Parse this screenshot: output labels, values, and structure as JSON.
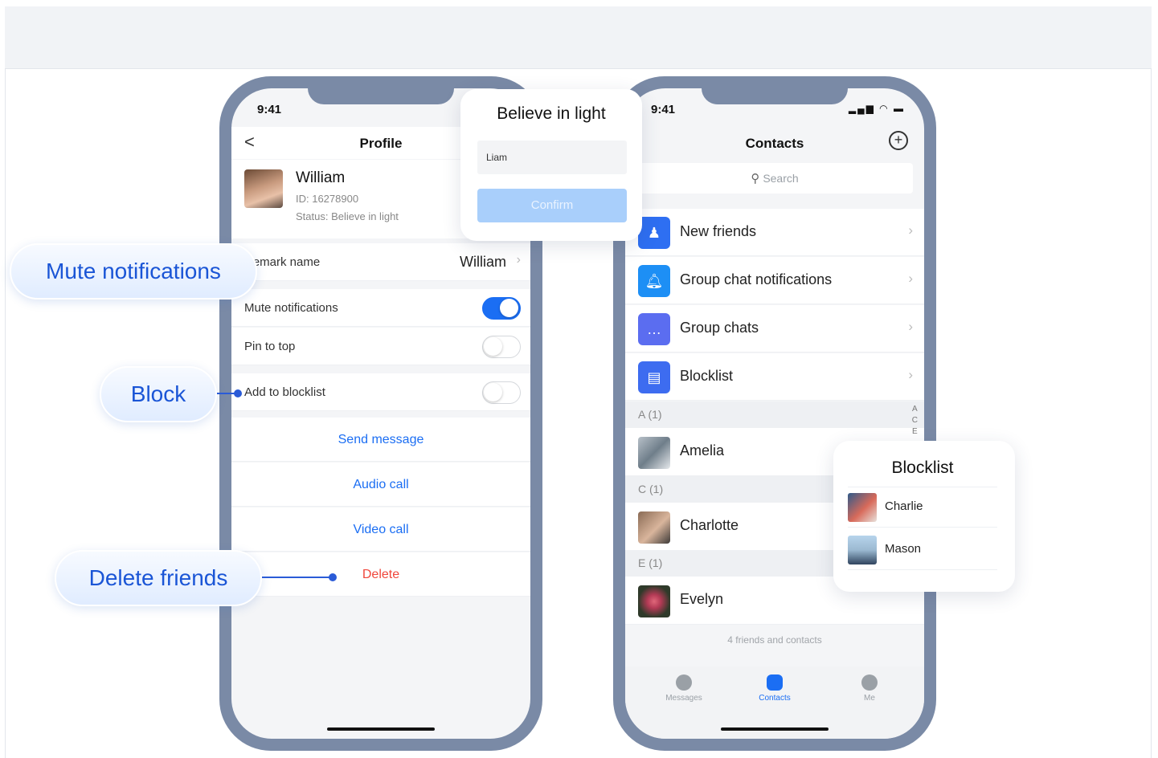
{
  "left_phone": {
    "time": "9:41",
    "nav": {
      "back": "<",
      "title": "Profile"
    },
    "profile": {
      "name": "William",
      "id": "ID: 16278900",
      "status": "Status: Believe in light"
    },
    "remark": {
      "label": "Remark name",
      "value": "William"
    },
    "toggles": [
      {
        "label": "Mute notifications",
        "on": true
      },
      {
        "label": "Pin to top",
        "on": false
      },
      {
        "label": "Add to blocklist",
        "on": false
      }
    ],
    "actions": [
      "Send message",
      "Audio call",
      "Video call",
      "Delete"
    ]
  },
  "status_popup": {
    "title": "Believe in light",
    "input_value": "Liam",
    "confirm_label": "Confirm"
  },
  "right_phone": {
    "time": "9:41",
    "title": "Contacts",
    "search_placeholder": "Search",
    "entries": [
      "New friends",
      "Group chat notifications",
      "Group chats",
      "Blocklist"
    ],
    "sections": [
      {
        "header": "A (1)",
        "contact": "Amelia"
      },
      {
        "header": "C (1)",
        "contact": "Charlotte"
      },
      {
        "header": "E (1)",
        "contact": "Evelyn"
      }
    ],
    "index": [
      "A",
      "C",
      "E"
    ],
    "footer": "4 friends and contacts",
    "tabs": [
      "Messages",
      "Contacts",
      "Me"
    ]
  },
  "blocklist_popup": {
    "title": "Blocklist",
    "items": [
      "Charlie",
      "Mason"
    ]
  },
  "callouts": {
    "mute": "Mute notifications",
    "block": "Block",
    "delete": "Delete friends"
  },
  "colors": {
    "accent": "#1b6ef3",
    "danger": "#f0473c",
    "phone_frame": "#7a8aa6"
  }
}
